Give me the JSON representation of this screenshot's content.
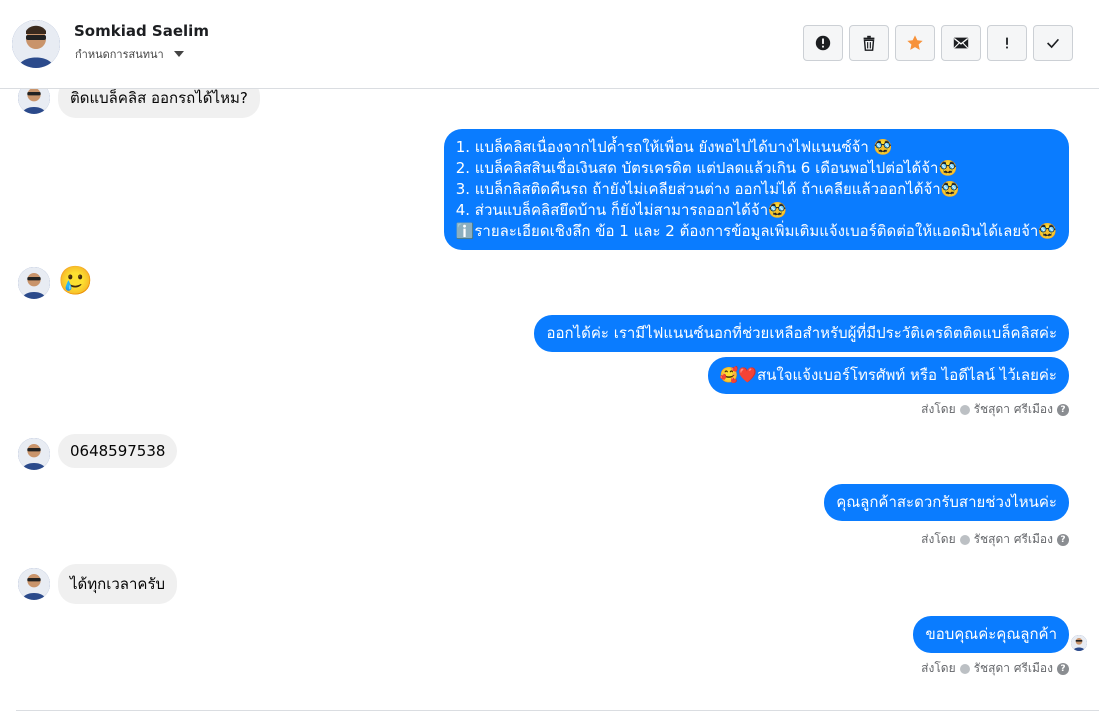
{
  "header": {
    "name": "Somkiad Saelim",
    "subtitle": "กำหนดการสนทนา",
    "toolbar": [
      {
        "name": "alert-circle-icon",
        "label": "!"
      },
      {
        "name": "trash-icon",
        "label": ""
      },
      {
        "name": "star-icon",
        "label": ""
      },
      {
        "name": "mail-icon",
        "label": ""
      },
      {
        "name": "exclamation-icon",
        "label": "!"
      },
      {
        "name": "check-icon",
        "label": ""
      }
    ]
  },
  "messages": {
    "m1": "ติดแบล็คลิส ออกรถได้ไหม?",
    "m2_lines": [
      "1. แบล็คลิสเนื่องจากไปค้ำรถให้เพื่อน ยังพอไปได้บางไฟแนนซ์จ้า 🥸",
      "2. แบล็คลิสสินเชื่อเงินสด บัตรเครดิต แต่ปลดแล้วเกิน 6 เดือนพอไปต่อได้จ้า🥸",
      "3. แบล็กลิสติดคืนรถ ถ้ายังไม่เคลียส่วนต่าง ออกไม่ได้ ถ้าเคลียแล้วออกได้จ้า🥸",
      "4. ส่วนแบล็คลิสยึดบ้าน ก็ยังไม่สามารถออกได้จ้า🥸",
      "ℹ️รายละเอียดเชิงลึก ข้อ 1 และ 2 ต้องการข้อมูลเพิ่มเติมแจ้งเบอร์ติดต่อให้แอดมินได้เลยจ้า🥸"
    ],
    "m3_emoji": "🥲",
    "m4": "ออกได้ค่ะ เรามีไฟแนนซ์นอกที่ช่วยเหลือสำหรับผู้ที่มีประวัติเครดิตติดแบล็คลิสค่ะ",
    "m5": "🥰❤️สนใจแจ้งเบอร์โทรศัพท์ หรือ ไอดีไลน์  ไว้เลยค่ะ",
    "m6": "0648597538",
    "m7": "คุณลูกค้าสะดวกรับสายช่วงไหนค่ะ",
    "m8": "ได้ทุกเวลาครับ",
    "m9": "ขอบคุณค่ะคุณลูกค้า"
  },
  "sent_meta": {
    "prefix": "ส่งโดย",
    "agent": "รัชสุดา ศรีเมือง",
    "help": "?"
  },
  "colors": {
    "outgoing": "#0a7cff",
    "incoming": "#f0f0f0",
    "star": "#f7923a"
  }
}
